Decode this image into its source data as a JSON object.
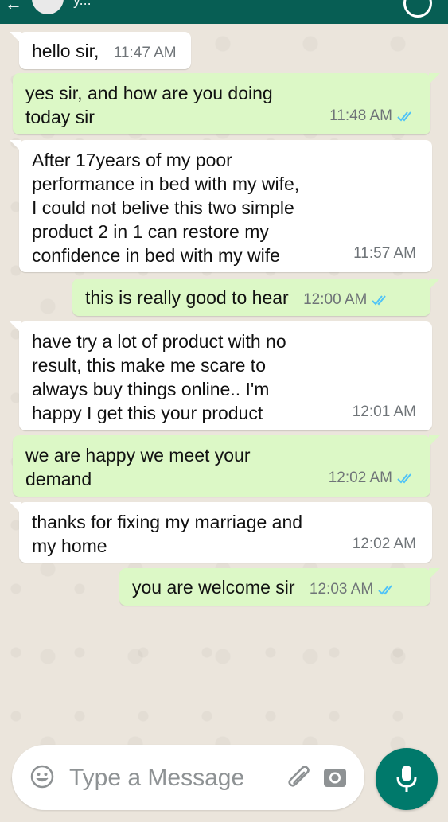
{
  "header": {
    "contact_name": "y..."
  },
  "messages": [
    {
      "dir": "in",
      "text": "hello sir,",
      "time": "11:47 AM"
    },
    {
      "dir": "out",
      "text": "yes sir, and how are you doing\ntoday sir",
      "time": "11:48 AM"
    },
    {
      "dir": "in",
      "text": "After 17years of my poor\nperformance in bed with my wife,\nI could not belive this two simple\nproduct 2 in 1 can restore my\nconfidence in bed with my wife",
      "time": "11:57 AM"
    },
    {
      "dir": "out",
      "text": "this is really good to hear",
      "time": "12:00 AM"
    },
    {
      "dir": "in",
      "text": "have try a lot of product with no\nresult, this make me scare to\nalways buy things online.. I'm\nhappy I get this your product",
      "time": "12:01 AM"
    },
    {
      "dir": "out",
      "text": "we are happy we meet your\ndemand",
      "time": "12:02 AM"
    },
    {
      "dir": "in",
      "text": "thanks for fixing my marriage and\nmy home",
      "time": "12:02 AM"
    },
    {
      "dir": "out",
      "text": "you are welcome sir",
      "time": "12:03 AM"
    }
  ],
  "composer": {
    "placeholder": "Type a Message"
  },
  "icons": {
    "emoji": "emoji-icon",
    "attach": "paperclip-icon",
    "camera": "camera-icon",
    "mic": "mic-icon",
    "read_receipt": "double-check-icon"
  },
  "colors": {
    "header": "#075e54",
    "outgoing_bubble": "#dcf8c6",
    "incoming_bubble": "#ffffff",
    "read_tick": "#4fc3f7",
    "mic_button": "#00796b"
  }
}
